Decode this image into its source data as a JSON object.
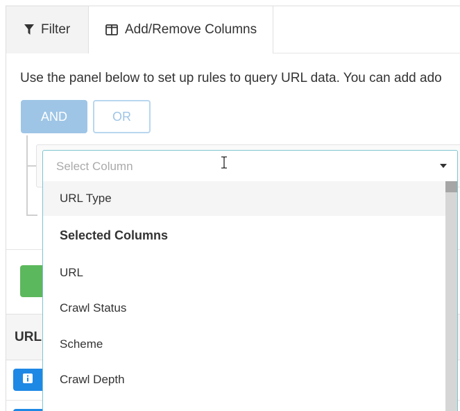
{
  "tabs": [
    {
      "label": "Filter",
      "icon": "filter-icon",
      "active": true
    },
    {
      "label": "Add/Remove Columns",
      "icon": "columns-icon",
      "active": false
    }
  ],
  "intro_text": "Use the panel below to set up rules to query URL data. You can add ado",
  "logic": {
    "and_label": "AND",
    "or_label": "OR"
  },
  "select": {
    "placeholder": "Select Column"
  },
  "table": {
    "first_header": "URL"
  },
  "dropdown": [
    {
      "label": "URL Type",
      "kind": "option",
      "highlighted": true
    },
    {
      "label": "Selected Columns",
      "kind": "group",
      "highlighted": false
    },
    {
      "label": "URL",
      "kind": "option",
      "highlighted": false
    },
    {
      "label": "Crawl Status",
      "kind": "option",
      "highlighted": false
    },
    {
      "label": "Scheme",
      "kind": "option",
      "highlighted": false
    },
    {
      "label": "Crawl Depth",
      "kind": "option",
      "highlighted": false
    }
  ],
  "colors": {
    "and_button": "#9ec5e6",
    "select_border": "#7fc4cf",
    "add_button": "#5cb85c",
    "info_badge": "#1e88e5"
  }
}
